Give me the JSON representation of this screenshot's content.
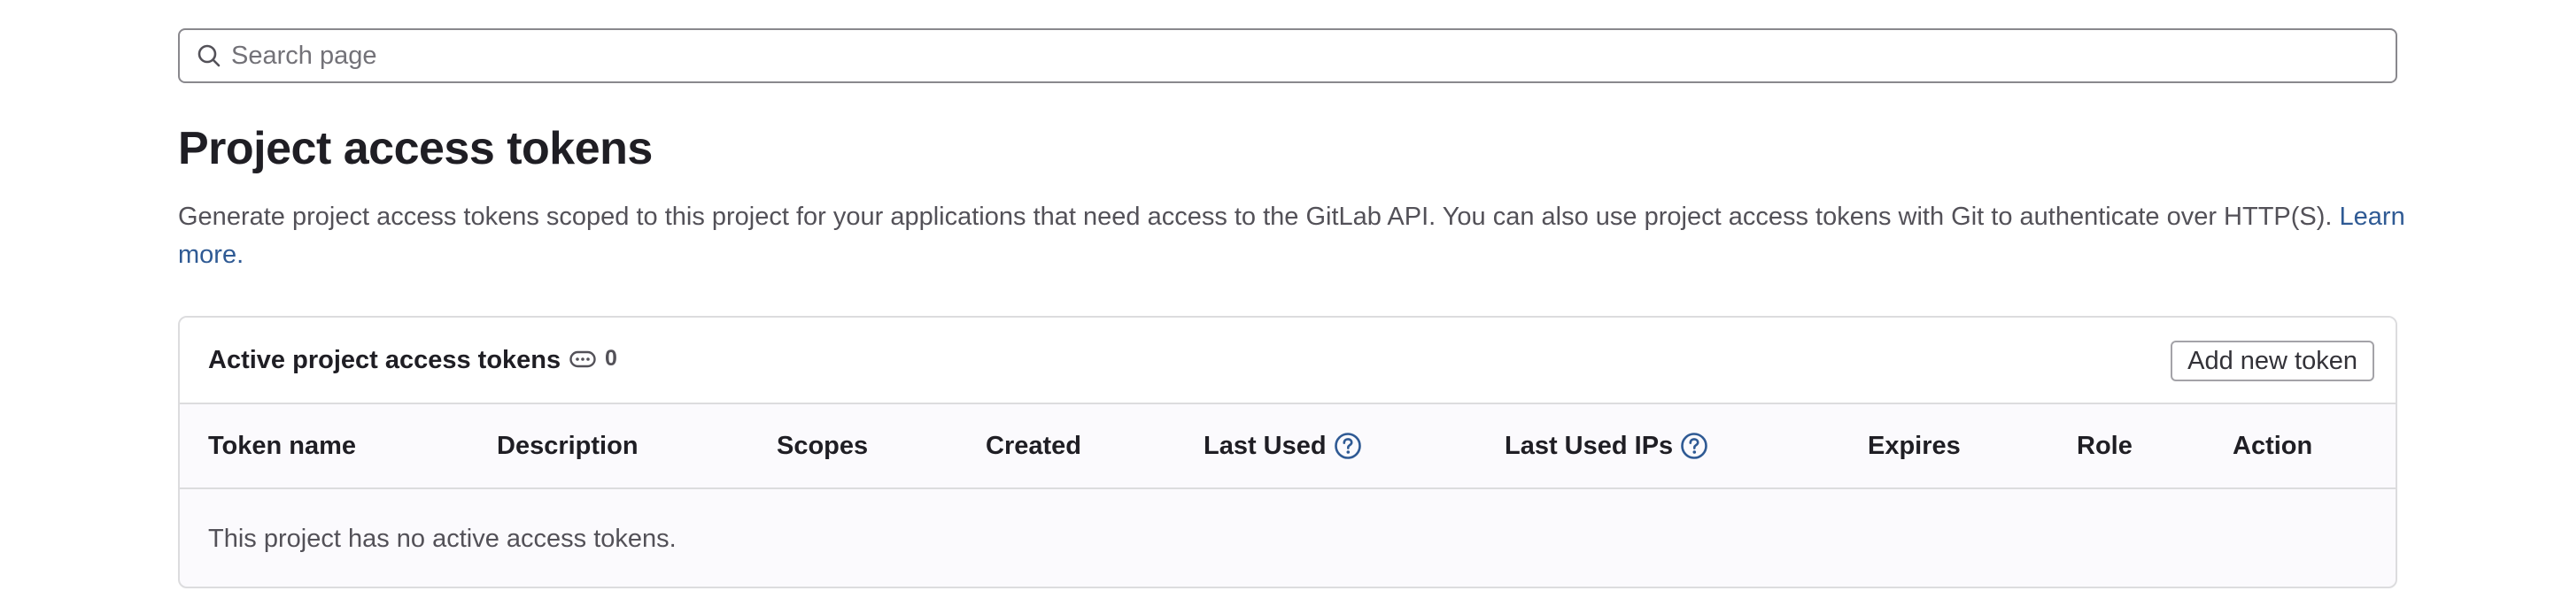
{
  "search": {
    "placeholder": "Search page",
    "icon": "search-icon"
  },
  "header": {
    "title": "Project access tokens",
    "description": "Generate project access tokens scoped to this project for your applications that need access to the GitLab API. You can also use project access tokens with Git to authenticate over HTTP(S).",
    "learn_more": "Learn more."
  },
  "card": {
    "title": "Active project access tokens",
    "count_icon": "token-icon",
    "count": "0",
    "add_button": "Add new token",
    "columns": [
      {
        "label": "Token name",
        "help": false
      },
      {
        "label": "Description",
        "help": false
      },
      {
        "label": "Scopes",
        "help": false
      },
      {
        "label": "Created",
        "help": false
      },
      {
        "label": "Last Used",
        "help": true
      },
      {
        "label": "Last Used IPs",
        "help": true
      },
      {
        "label": "Expires",
        "help": false
      },
      {
        "label": "Role",
        "help": false
      },
      {
        "label": "Action",
        "help": false
      }
    ],
    "empty_message": "This project has no active access tokens."
  },
  "colors": {
    "link": "#2f5a94",
    "border": "#dcdcde",
    "help_icon": "#2f5a94"
  }
}
